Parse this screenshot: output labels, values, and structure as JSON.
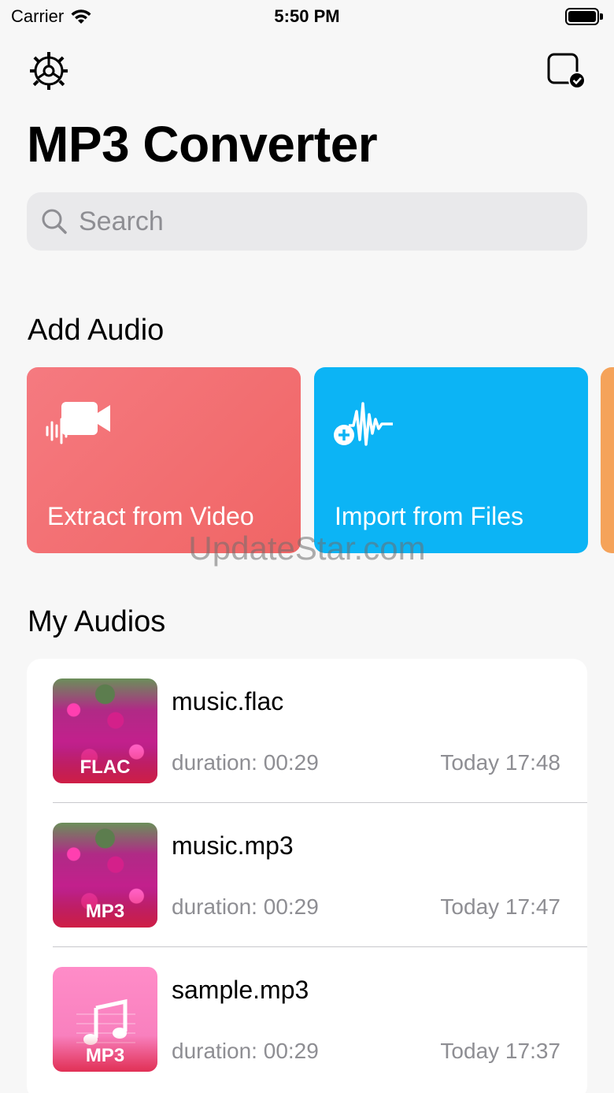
{
  "status_bar": {
    "carrier": "Carrier",
    "time": "5:50 PM"
  },
  "header": {
    "title": "MP3 Converter"
  },
  "search": {
    "placeholder": "Search"
  },
  "add_audio": {
    "title": "Add Audio",
    "cards": [
      {
        "label": "Extract from Video",
        "icon": "video-audio-icon",
        "color": "#f26d72"
      },
      {
        "label": "Import from Files",
        "icon": "waveform-add-icon",
        "color": "#0cb4f5"
      }
    ]
  },
  "watermark": "UpdateStar.com",
  "my_audios": {
    "title": "My Audios",
    "items": [
      {
        "name": "music.flac",
        "badge": "FLAC",
        "duration": "duration: 00:29",
        "date": "Today 17:48"
      },
      {
        "name": "music.mp3",
        "badge": "MP3",
        "duration": "duration: 00:29",
        "date": "Today 17:47"
      },
      {
        "name": "sample.mp3",
        "badge": "MP3",
        "duration": "duration: 00:29",
        "date": "Today 17:37"
      }
    ]
  }
}
